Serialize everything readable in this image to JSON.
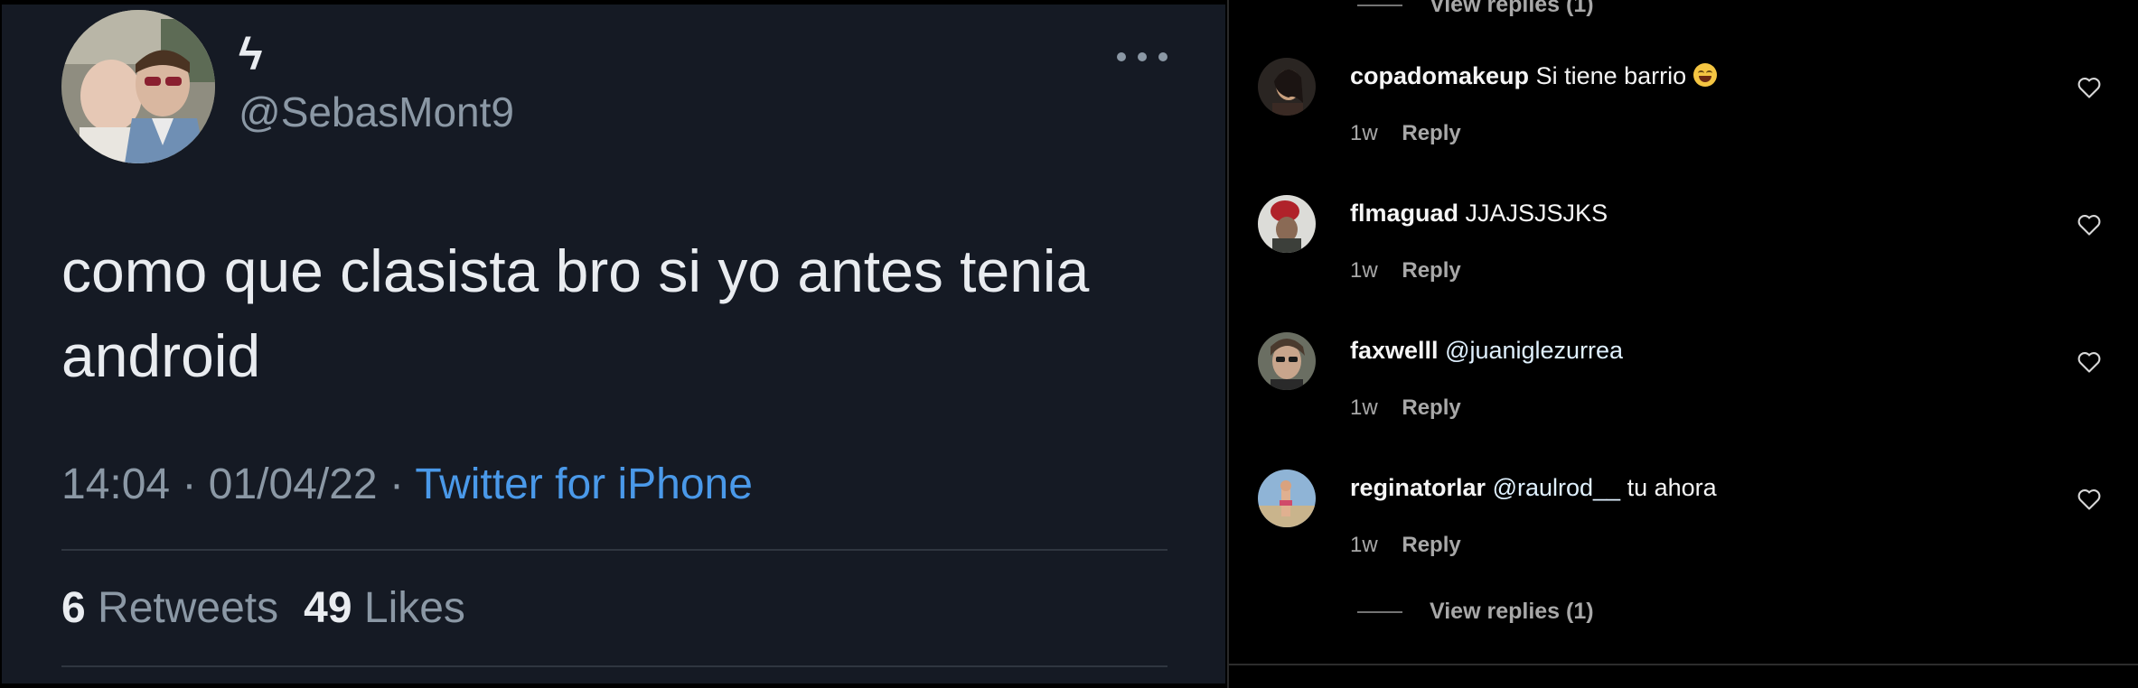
{
  "tweet": {
    "display_name": "ϟ",
    "handle": "@SebasMont9",
    "text": "como que clasista bro si yo antes tenia android",
    "time": "14:04",
    "date": "01/04/22",
    "separator": " · ",
    "source": "Twitter for iPhone",
    "retweets_count": "6",
    "retweets_label": "Retweets",
    "likes_count": "49",
    "likes_label": "Likes",
    "more_icon": "more-horizontal-icon"
  },
  "comments_panel": {
    "view_replies_label": "View replies (1)",
    "comments": [
      {
        "username": "copadomakeup",
        "text": "Si tiene barrio",
        "emoji": "😂",
        "mention": "",
        "time": "1w",
        "reply_label": "Reply"
      },
      {
        "username": "flmaguad",
        "text": "JJAJSJSJKS",
        "mention": "",
        "time": "1w",
        "reply_label": "Reply"
      },
      {
        "username": "faxwelll",
        "text": "",
        "mention": "@juaniglezurrea",
        "time": "1w",
        "reply_label": "Reply"
      },
      {
        "username": "reginatorlar",
        "text": "tu ahora",
        "mention": "@raulrod__",
        "time": "1w",
        "reply_label": "Reply"
      }
    ]
  },
  "colors": {
    "tweet_bg": "#151a24",
    "link_blue": "#4a99e9",
    "muted_text": "#8b98a5",
    "comments_bg": "#000000"
  }
}
